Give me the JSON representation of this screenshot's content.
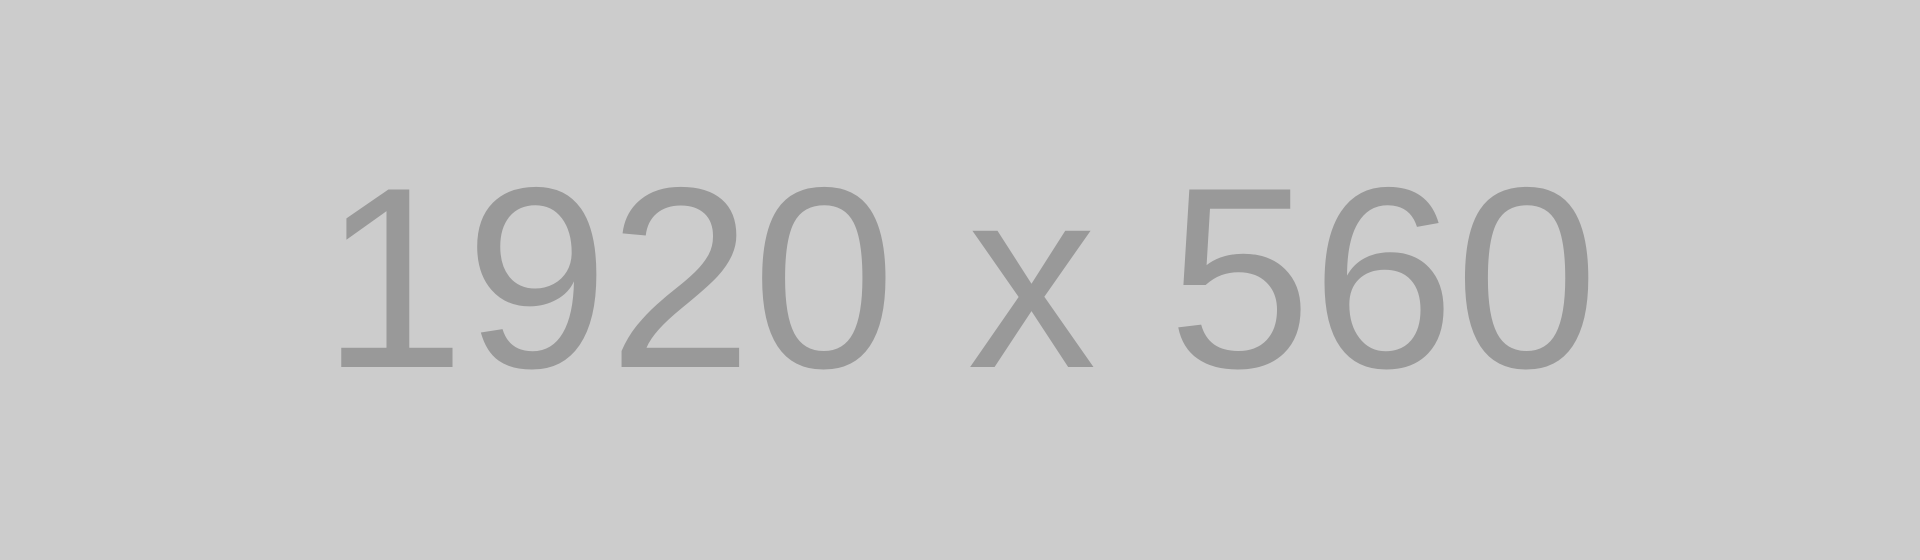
{
  "placeholder": {
    "label": "1920 x 560",
    "background_color": "#cccccc",
    "text_color": "#999999"
  }
}
